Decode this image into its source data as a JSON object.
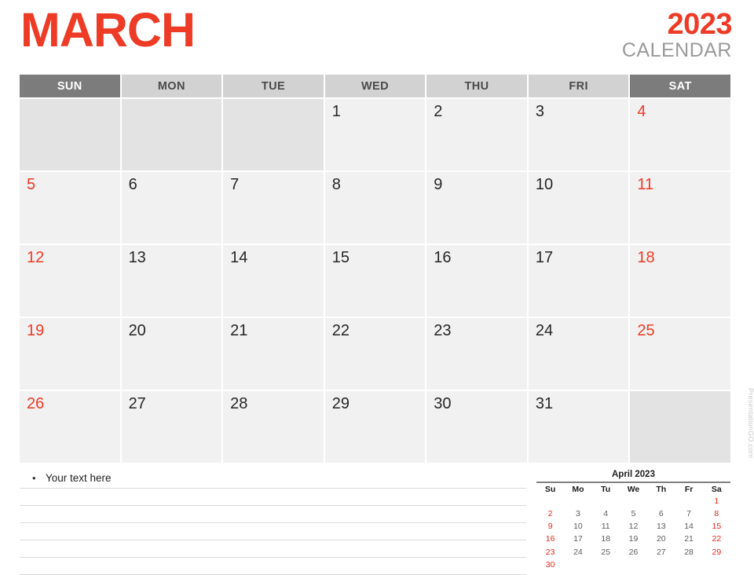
{
  "header": {
    "month": "MARCH",
    "year": "2023",
    "subtitle": "CALENDAR"
  },
  "colors": {
    "accent_red": "#ED3B26",
    "header_dark": "#7c7c7c",
    "header_light": "#d2d2d2",
    "cell_bg": "#f1f1f1",
    "cell_blank_bg": "#e3e3e3"
  },
  "calendar": {
    "day_headers": [
      "SUN",
      "MON",
      "TUE",
      "WED",
      "THU",
      "FRI",
      "SAT"
    ],
    "weeks": [
      [
        "",
        "",
        "",
        "1",
        "2",
        "3",
        "4"
      ],
      [
        "5",
        "6",
        "7",
        "8",
        "9",
        "10",
        "11"
      ],
      [
        "12",
        "13",
        "14",
        "15",
        "16",
        "17",
        "18"
      ],
      [
        "19",
        "20",
        "21",
        "22",
        "23",
        "24",
        "25"
      ],
      [
        "26",
        "27",
        "28",
        "29",
        "30",
        "31",
        ""
      ]
    ]
  },
  "notes": {
    "bullet": "•",
    "first_line": "Your text here",
    "blank_line_count": 5
  },
  "mini_calendar": {
    "title": "April 2023",
    "day_headers": [
      "Su",
      "Mo",
      "Tu",
      "We",
      "Th",
      "Fr",
      "Sa"
    ],
    "weeks": [
      [
        "",
        "",
        "",
        "",
        "",
        "",
        "1"
      ],
      [
        "2",
        "3",
        "4",
        "5",
        "6",
        "7",
        "8"
      ],
      [
        "9",
        "10",
        "11",
        "12",
        "13",
        "14",
        "15"
      ],
      [
        "16",
        "17",
        "18",
        "19",
        "20",
        "21",
        "22"
      ],
      [
        "23",
        "24",
        "25",
        "26",
        "27",
        "28",
        "29"
      ],
      [
        "30",
        "",
        "",
        "",
        "",
        "",
        ""
      ]
    ]
  },
  "watermark": "PresentationGO.com"
}
